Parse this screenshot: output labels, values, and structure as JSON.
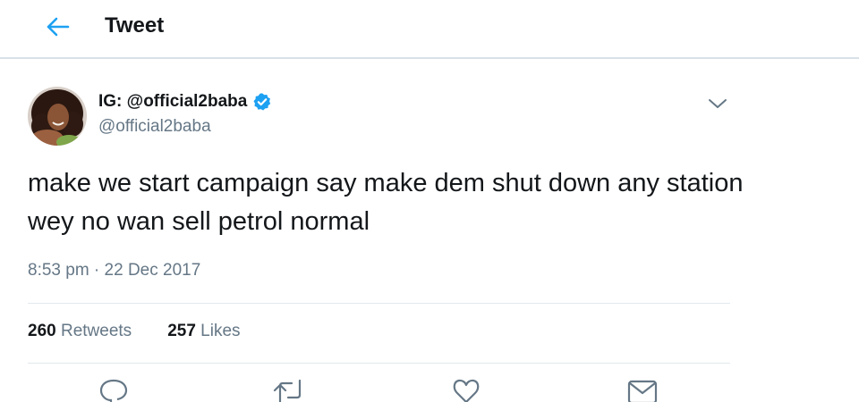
{
  "header": {
    "title": "Tweet",
    "back_icon": "arrow-left-icon",
    "accent_color": "#1da1f2"
  },
  "tweet": {
    "display_name": "IG: @official2baba",
    "handle": "@official2baba",
    "verified": true,
    "text": "make we start campaign say make dem shut down any station wey no wan sell petrol normal",
    "timestamp": "8:53 pm · 22 Dec 2017",
    "stats": {
      "retweets_count": "260",
      "retweets_label": "Retweets",
      "likes_count": "257",
      "likes_label": "Likes"
    },
    "actions": [
      "reply-icon",
      "retweet-icon",
      "like-icon",
      "direct-message-icon"
    ]
  },
  "colors": {
    "text_primary": "#14171a",
    "text_secondary": "#657786",
    "divider": "#e1e8ed",
    "verified_badge": "#1da1f2"
  }
}
